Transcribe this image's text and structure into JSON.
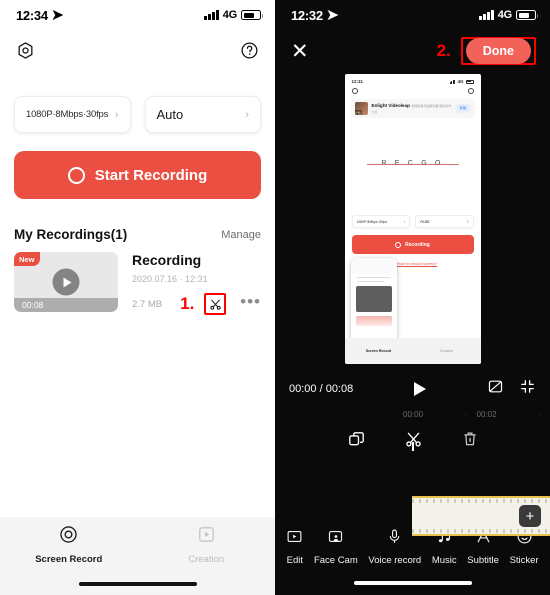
{
  "left": {
    "status": {
      "time": "12:34",
      "network": "4G"
    },
    "topbar": {
      "settings_icon": "hex-gear-icon",
      "help_icon": "question-circle-icon"
    },
    "selectors": [
      {
        "label": "1080P·8Mbps·30fps",
        "chevron": "›"
      },
      {
        "label": "Auto",
        "chevron": "›"
      }
    ],
    "record_button": {
      "label": "Start Recording"
    },
    "recordings": {
      "section_title": "My Recordings(1)",
      "manage_label": "Manage",
      "item": {
        "badge": "New",
        "duration": "00:08",
        "title": "Recording",
        "date": "2020.07.16 · 12:31",
        "size": "2.7 MB",
        "annotation": "1.",
        "cut_icon": "scissors-icon",
        "more_icon": "•••"
      }
    },
    "tabs": [
      {
        "label": "Screen Record",
        "icon": "record-circle-icon",
        "active": true
      },
      {
        "label": "Creation",
        "icon": "play-square-icon",
        "active": false
      }
    ]
  },
  "right": {
    "status": {
      "time": "12:32",
      "network": "4G"
    },
    "topbar": {
      "close_icon": "close-x-icon",
      "annotation": "2.",
      "done_label": "Done"
    },
    "preview": {
      "status_time": "12:31",
      "status_network": "4G",
      "ad": {
        "title": "Enlight Videoleap",
        "subtitle": "视频剪辑与编辑利器,轻松创作大片",
        "button": "安装",
        "tag": "广告"
      },
      "logo": "R E C G O",
      "selectors": [
        "1080P·8Mbps·30fps",
        "Auto"
      ],
      "record_label": "Recording",
      "howto_label": "How to record screen?",
      "tabs": [
        "Screen Record",
        "Creation"
      ]
    },
    "playback": {
      "time_display": "00:00 / 00:08",
      "play_icon": "play-icon",
      "aspect_icon": "aspect-ratio-icon",
      "fullscreen_icon": "exit-fullscreen-icon"
    },
    "ruler": {
      "labels": [
        "00:00",
        "00:02"
      ],
      "dot": "·"
    },
    "edit_tools": [
      {
        "name": "duplicate-icon"
      },
      {
        "name": "split-scissors-icon"
      },
      {
        "name": "delete-trash-icon"
      }
    ],
    "timeline": {
      "add_label": "+"
    },
    "bottom_tools": [
      {
        "label": "Edit",
        "icon": "edit-clip-icon"
      },
      {
        "label": "Face Cam",
        "icon": "face-cam-icon"
      },
      {
        "label": "Voice record",
        "icon": "microphone-icon"
      },
      {
        "label": "Music",
        "icon": "music-note-icon"
      },
      {
        "label": "Subtitle",
        "icon": "subtitle-a-icon"
      },
      {
        "label": "Sticker",
        "icon": "smiley-sticker-icon"
      }
    ]
  },
  "colors": {
    "accent_red": "#ea4f42",
    "annotation_red": "#ff0000",
    "clip_border": "#e8c14a"
  }
}
